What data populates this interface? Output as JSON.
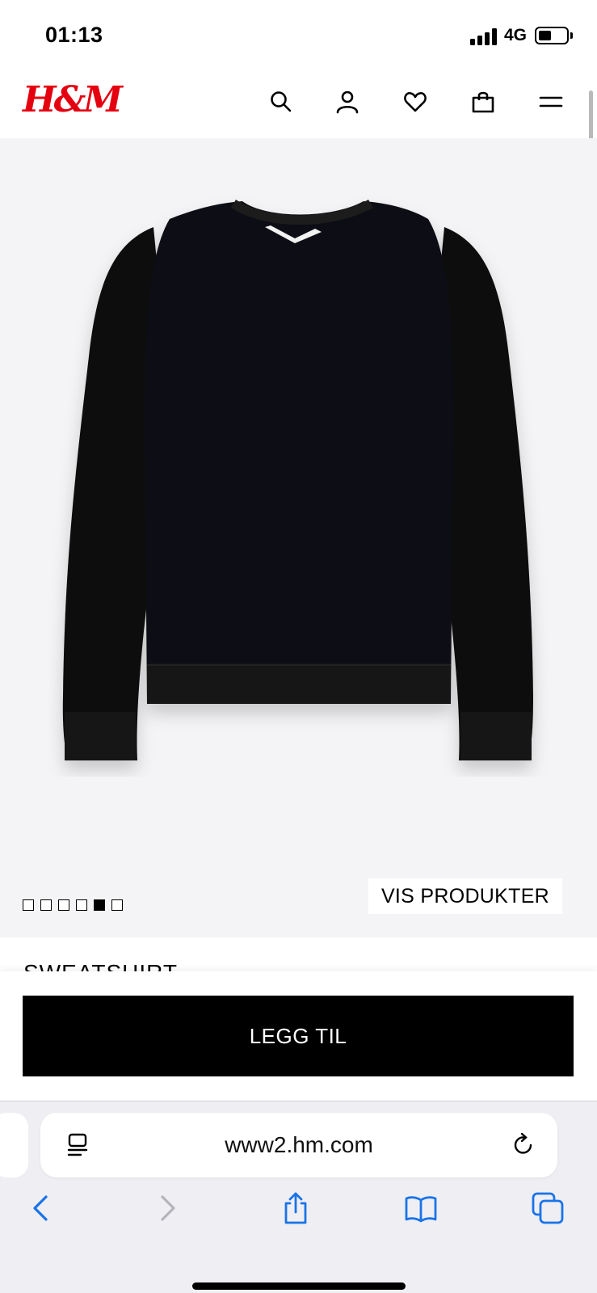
{
  "status_bar": {
    "time": "01:13",
    "network": "4G"
  },
  "header": {
    "logo": "H&M",
    "icons": [
      "search-icon",
      "account-icon",
      "heart-icon",
      "bag-icon",
      "menu-icon"
    ]
  },
  "product": {
    "image_count": 6,
    "active_image_index": 4,
    "show_products_label": "VIS PRODUKTER",
    "title": "SWEATSHIRT",
    "add_to_cart_label": "LEGG TIL"
  },
  "browser": {
    "url": "www2.hm.com",
    "toolbar": [
      "back-icon",
      "forward-icon",
      "share-icon",
      "bookmarks-icon",
      "tabs-icon"
    ]
  },
  "colors": {
    "brand_red": "#e50010",
    "primary_button": "#000000",
    "ios_blue": "#1a73e8",
    "image_background": "#f4f4f6"
  }
}
